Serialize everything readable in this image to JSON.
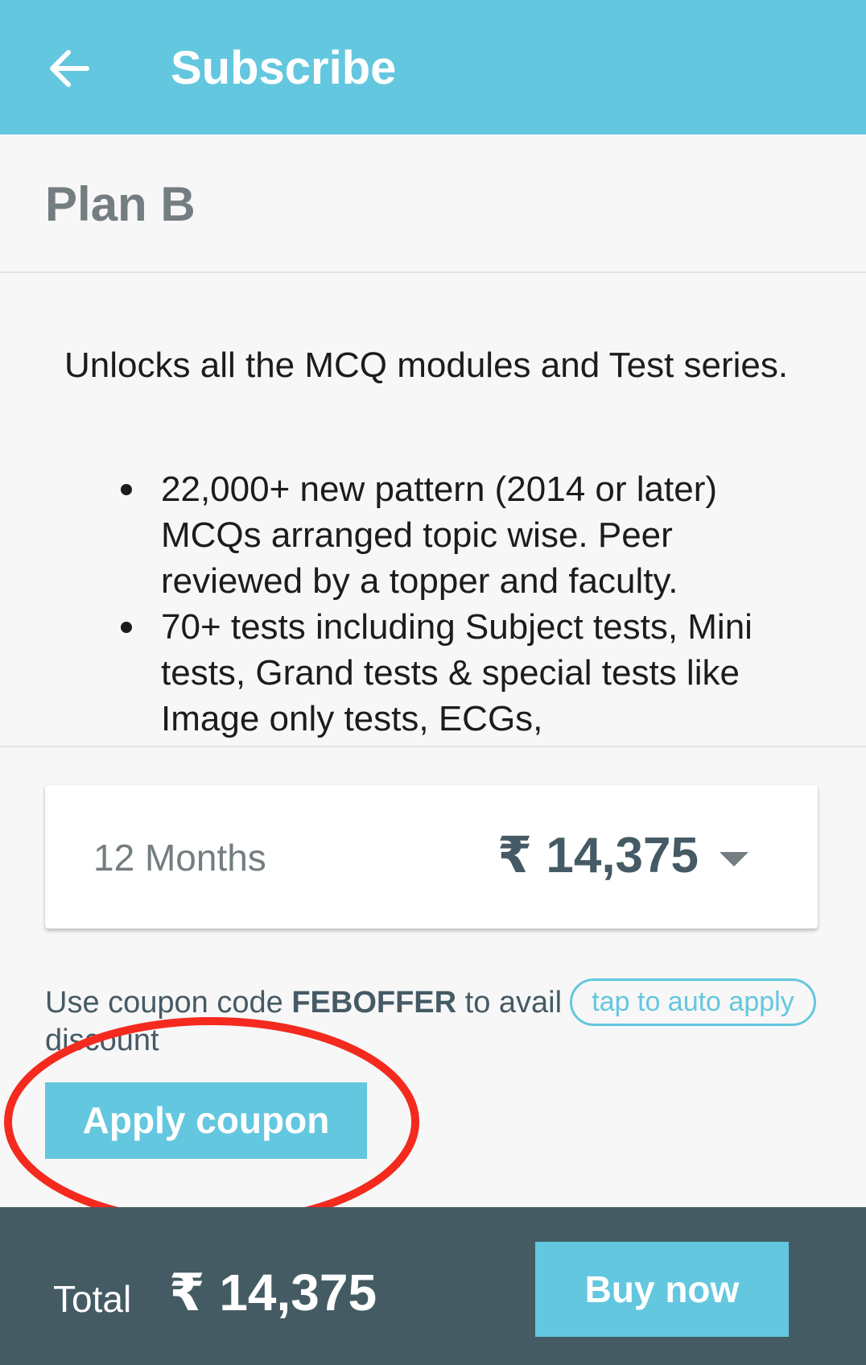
{
  "appbar": {
    "title": "Subscribe",
    "back_icon": "arrow-left-icon"
  },
  "plan": {
    "name": "Plan B",
    "intro": "Unlocks all the MCQ modules and Test series.",
    "features": [
      "22,000+ new pattern (2014 or later) MCQs arranged topic wise. Peer reviewed by a topper and faculty.",
      "70+ tests including Subject tests, Mini tests, Grand tests & special tests like Image only tests, ECGs,"
    ]
  },
  "price_selector": {
    "duration": "12 Months",
    "price": "₹ 14,375",
    "dropdown_icon": "caret-down-icon"
  },
  "coupon": {
    "prefix": "Use coupon code ",
    "code": "FEBOFFER",
    "suffix": " to avail discount",
    "auto_apply_label": "tap to auto apply",
    "apply_label": "Apply coupon"
  },
  "footer": {
    "total_label": "Total",
    "total_value": "₹ 14,375",
    "buy_label": "Buy now"
  },
  "colors": {
    "accent": "#63c7df",
    "footer_bg": "#445b63",
    "annotation": "#f42a1e"
  }
}
